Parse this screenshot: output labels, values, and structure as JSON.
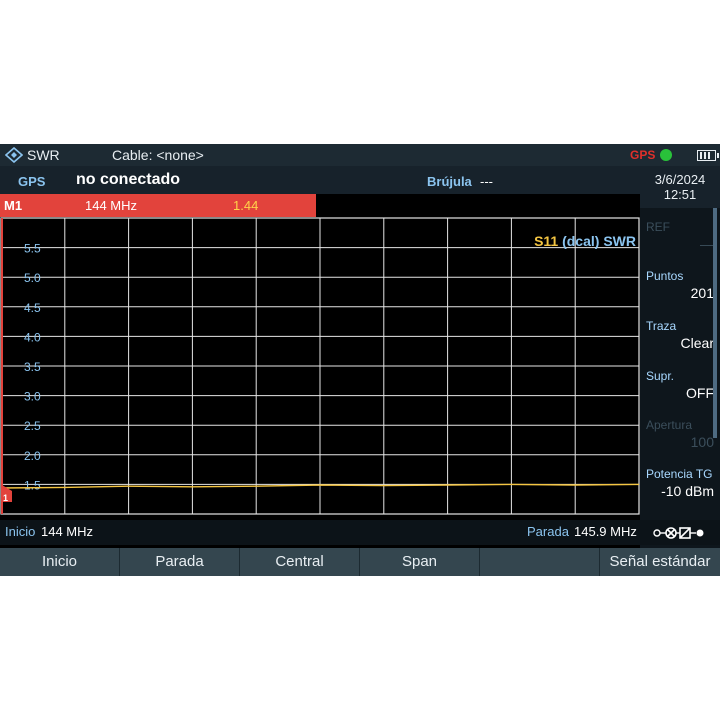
{
  "topbar": {
    "mode": "SWR",
    "cable": "Cable: <none>",
    "gps_indicator": "GPS"
  },
  "info": {
    "gps_label": "GPS",
    "gps_status": "no conectado",
    "compass_label": "Brújula",
    "compass_value": "---"
  },
  "datetime": {
    "date": "3/6/2024",
    "time": "12:51"
  },
  "marker": {
    "name": "M1",
    "freq": "144 MHz",
    "value": "1.44",
    "flag": "1"
  },
  "plot_label": {
    "param": "S11",
    "cal": "(dcal)",
    "mode": "SWR"
  },
  "chart_data": {
    "type": "line",
    "ylim": [
      1.0,
      6.0
    ],
    "y_ticks": [
      "1.5",
      "2.0",
      "2.5",
      "3.0",
      "3.5",
      "4.0",
      "4.5",
      "5.0",
      "5.5"
    ],
    "x": [
      144.0,
      144.19,
      144.38,
      144.57,
      144.76,
      144.95,
      145.14,
      145.33,
      145.52,
      145.71,
      145.9
    ],
    "series": [
      {
        "values": [
          1.44,
          1.45,
          1.47,
          1.46,
          1.47,
          1.49,
          1.48,
          1.49,
          1.5,
          1.49,
          1.5
        ]
      }
    ],
    "grid": true
  },
  "side": [
    {
      "label": "REF",
      "value": "—",
      "disabled": true
    },
    {
      "label": "Puntos",
      "value": "201",
      "disabled": false
    },
    {
      "label": "Traza",
      "value": "Clear",
      "disabled": false
    },
    {
      "label": "Supr.",
      "value": "OFF",
      "disabled": false
    },
    {
      "label": "Apertura",
      "value": "100",
      "disabled": true
    },
    {
      "label": "Potencia TG",
      "value": "-10 dBm",
      "disabled": false
    }
  ],
  "freq": {
    "start_label": "Inicio",
    "start_value": "144 MHz",
    "stop_label": "Parada",
    "stop_value": "145.9 MHz"
  },
  "softkeys": [
    "Inicio",
    "Parada",
    "Central",
    "Span",
    "",
    "Señal estándar"
  ],
  "colors": {
    "trace": "#f4c542",
    "marker": "#e2433c",
    "grid": "#e6e6e6",
    "label_blue": "#8bc4ef"
  }
}
